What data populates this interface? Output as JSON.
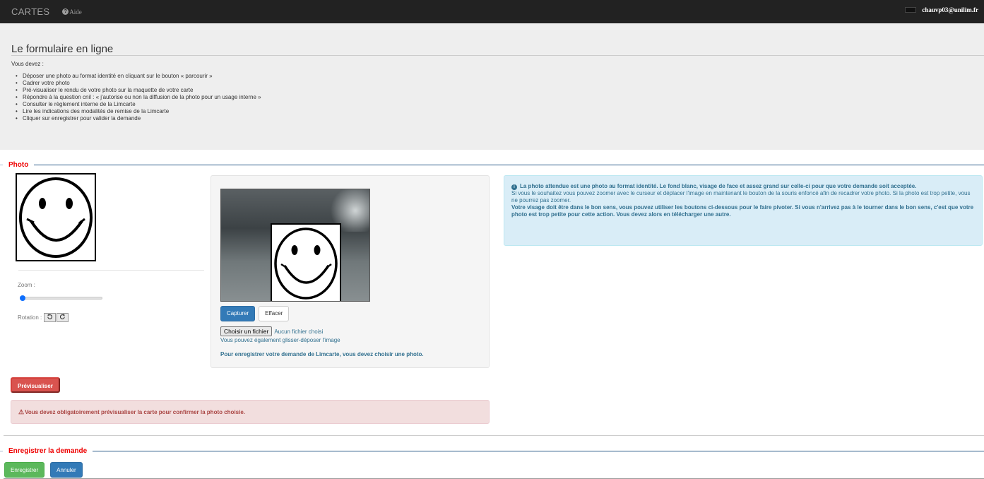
{
  "navbar": {
    "brand": "CARTES",
    "help": "Aide",
    "user": "chauvp03@unilim.fr"
  },
  "intro": {
    "title": "Le formulaire en ligne",
    "lead": "Vous devez :",
    "items": [
      "Déposer une photo au format identité en cliquant sur le bouton « parcourir »",
      "Cadrer votre photo",
      "Pré-visualiser le rendu de votre photo sur la maquette de votre carte",
      "Répondre à la question cnil : « j'autorise ou non la diffusion de la photo pour un usage interne »",
      "Consulter le règlement interne de la Limcarte",
      "Lire les indications des modalités de remise de la Limcarte",
      "Cliquer sur enregistrer pour valider la demande"
    ]
  },
  "photo": {
    "legend": "Photo",
    "zoom_label": "Zoom :",
    "zoom_value": 0,
    "rotation_label": "Rotation :",
    "capture_label": "Capturer",
    "clear_label": "Effacer",
    "file_button": "Choisir un fichier",
    "no_file": "Aucun fichier choisi",
    "drag_text": "Vous pouvez également glisser-déposer l'image",
    "choose_text": "Pour enregistrer votre demande de Limcarte, vous devez choisir une photo."
  },
  "info": {
    "line1": "La photo attendue est une photo au format identité. Le fond blanc, visage de face et assez grand sur celle-ci pour que votre demande soit acceptée.",
    "line2": "Si vous le souhaitez vous pouvez zoomer avec le curseur et déplacer l'image en maintenant le bouton de la souris enfoncé afin de recadrer votre photo. Si la photo est trop petite, vous ne pourrez pas zoomer.",
    "line3": "Votre visage doit être dans le bon sens, vous pouvez utiliser les boutons ci-dessous pour le faire pivoter. Si vous n'arrivez pas à le tourner dans le bon sens, c'est que votre photo est trop petite pour cette action. Vous devez alors en télécharger une autre."
  },
  "preview_button": "Prévisualiser",
  "alert_text": "Vous devez obligatoirement prévisualiser la carte pour confirmer la photo choisie.",
  "save": {
    "legend": "Enregistrer la demande",
    "save_label": "Enregistrer",
    "cancel_label": "Annuler"
  },
  "colors": {
    "danger": "#d9534f",
    "primary": "#337ab7",
    "success": "#5cb85c",
    "info_bg": "#d9edf7",
    "legend_red": "#e00000"
  }
}
